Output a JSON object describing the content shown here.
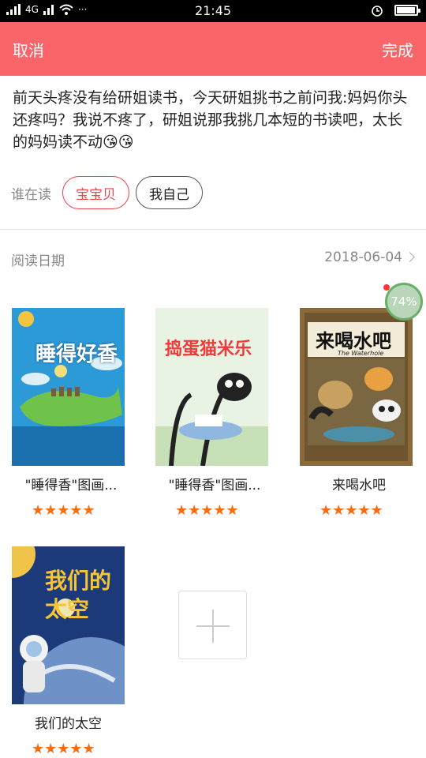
{
  "status_bar": {
    "signal_left": "ıl",
    "network": "4G",
    "wifi_icon": "wifi-icon",
    "dots": "···",
    "time": "21:45",
    "alarm_icon": "alarm-icon",
    "battery_icon": "battery-icon"
  },
  "header": {
    "cancel_label": "取消",
    "done_label": "完成",
    "bg_color": "#f96569"
  },
  "post": {
    "text": "前天头疼没有给研姐读书，今天研姐挑书之前问我:妈妈你头还疼吗？我说不疼了，研姐说那我挑几本短的书读吧，太长的妈妈读不动😘😘"
  },
  "reader": {
    "label": "谁在读",
    "options": [
      {
        "label": "宝宝贝",
        "selected": true
      },
      {
        "label": "我自己",
        "selected": false
      }
    ]
  },
  "reading_date": {
    "label": "阅读日期",
    "value": "2018-06-04"
  },
  "books": [
    {
      "title": "\"睡得香\"图画...",
      "cover_title": "睡得好香",
      "rating": 5
    },
    {
      "title": "\"睡得香\"图画...",
      "cover_title": "捣蛋猫米乐",
      "rating": 5
    },
    {
      "title": "来喝水吧",
      "cover_title": "来喝水吧",
      "cover_subtitle": "The Waterhole",
      "rating": 5,
      "progress": "74%"
    },
    {
      "title": "我们的太空",
      "cover_title": "我们的太空",
      "rating": 5
    }
  ],
  "stars": "★★★★★",
  "accent_star_color": "#f36d16"
}
